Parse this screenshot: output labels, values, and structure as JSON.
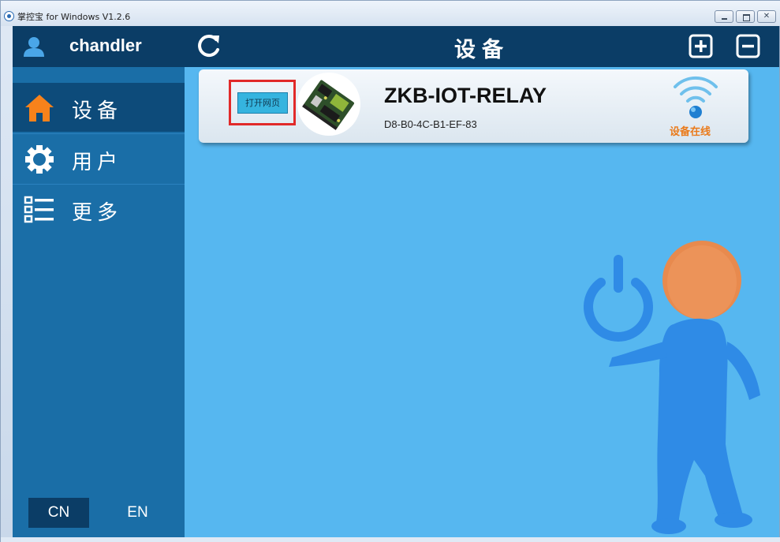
{
  "window": {
    "title": "掌控宝 for Windows V1.2.6",
    "buttons": {
      "minimize": "minimize",
      "maximize": "maximize",
      "close": "✕"
    }
  },
  "sidebar": {
    "username": "chandler",
    "items": [
      {
        "label": "设备",
        "icon": "home-icon",
        "active": true
      },
      {
        "label": "用户",
        "icon": "gear-icon",
        "active": false
      },
      {
        "label": "更多",
        "icon": "list-icon",
        "active": false
      }
    ],
    "languages": [
      {
        "label": "CN",
        "selected": true
      },
      {
        "label": "EN",
        "selected": false
      }
    ]
  },
  "header": {
    "title": "设备",
    "icons": {
      "refresh": "refresh-icon",
      "add": "add-icon",
      "remove": "remove-icon"
    }
  },
  "device": {
    "open_button": "打开网页",
    "name": "ZKB-IOT-RELAY",
    "mac": "D8-B0-4C-B1-EF-83",
    "status": "设备在线",
    "status_icon": "wifi-signal-icon"
  },
  "colors": {
    "sidebar_dark": "#0b3d66",
    "sidebar": "#1a6ea7",
    "main_bg": "#56b7f0",
    "accent_orange": "#f7821b",
    "highlight_red": "#e12a2a",
    "status_orange": "#ea7a1a"
  }
}
